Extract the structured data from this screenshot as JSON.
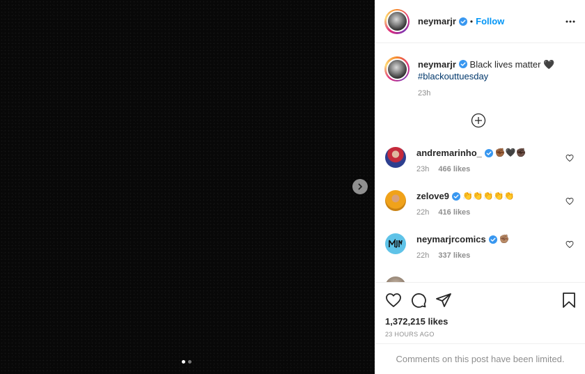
{
  "post": {
    "author": "neymarjr",
    "follow_label": "Follow",
    "separator": "•",
    "caption_text": "Black lives matter 🖤",
    "caption_hashtag": "#blackouttuesday",
    "caption_time": "23h",
    "media_slide_count": 2,
    "media_active_slide": 1
  },
  "comments": [
    {
      "username": "andremarinho_",
      "emoji": "✊🏾🖤✊🏿",
      "time": "23h",
      "likes": "466 likes"
    },
    {
      "username": "zelove9",
      "emoji": "👏👏👏👏👏",
      "time": "22h",
      "likes": "416 likes"
    },
    {
      "username": "neymarjrcomics",
      "emoji": "✊🏽",
      "time": "22h",
      "likes": "337 likes"
    }
  ],
  "footer": {
    "likes_total": "1,372,215 likes",
    "posted_ago": "23 HOURS AGO",
    "comments_limited": "Comments on this post have been limited."
  },
  "colors": {
    "link_blue": "#0095f6",
    "hashtag": "#00376b",
    "verified": "#3897f0",
    "muted": "#8e8e8e"
  },
  "icons": {
    "more": "more-options-icon",
    "like": "heart-icon",
    "comment": "comment-icon",
    "share": "share-icon",
    "save": "bookmark-icon",
    "load_more": "plus-circle-icon",
    "next": "chevron-right-icon"
  }
}
